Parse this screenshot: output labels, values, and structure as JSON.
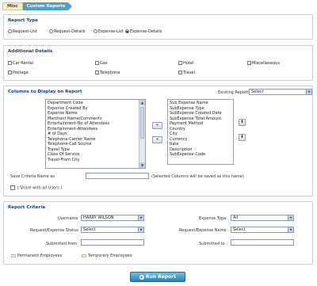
{
  "breadcrumb": {
    "misc": "Misc",
    "current": "Custom Reports"
  },
  "report_type": {
    "title": "Report Type",
    "options": [
      "Request-List",
      "Request-Details",
      "Expense-List",
      "Expense-Details"
    ],
    "selected": "Expense-Details"
  },
  "additional_details": {
    "title": "Additional Details",
    "checkboxes": [
      "Car Rental",
      "Gas",
      "Hotel",
      "Miscellaneous",
      "Postage",
      "Telephone",
      "Travel"
    ]
  },
  "columns": {
    "title": "Columns to Display on Report",
    "existing_reports_label": "Existing Reports",
    "existing_reports_value": "Select",
    "available": [
      "Department Code",
      "Expense Created By",
      "Expense Name",
      "Merchant Name/Comments",
      "Entertainment-No of Attendees",
      "Entertainment-Attendees",
      "# of Days",
      "Telephone-Carrier Name",
      "Telephone-Call Source",
      "Travel Type",
      "Class Of Service",
      "Travel-From City"
    ],
    "selected": [
      "Sub Expense Name",
      "SubExpense Type",
      "SubExpense Created Date",
      "SubExpense Total Amount",
      "Payment Method",
      "Country",
      "City",
      "Currency",
      "Rate",
      "Description",
      "SubExpense Code"
    ],
    "move_right": "»",
    "move_left": "«",
    "move_up": "⬆",
    "move_down": "⬇",
    "save_criteria_label": "Save Criteria Name as",
    "save_criteria_value": "",
    "save_hint": "(Selected Columns will be saved as this name)",
    "share_label": "( Share with all Users )"
  },
  "criteria": {
    "title": "Report Criteria",
    "username_label": "Username",
    "username_value": "HARRY WILSON",
    "expense_type_label": "Expense Type",
    "expense_type_value": "All",
    "req_status_label": "Request/Expense Status",
    "req_status_value": "Select",
    "req_name_label": "Request/Expense Name",
    "req_name_value": "Select",
    "submitted_from_label": "Submitted from",
    "submitted_from_value": "",
    "submitted_to_label": "Submitted to",
    "submitted_to_value": "",
    "legend_permanent": "Permanent Employees",
    "legend_temporary": "Temporary Employees"
  },
  "run_button": "Run Report",
  "colors": {
    "accent": "#4ea1c4",
    "title_blue": "#1b3d7a",
    "legend_permanent": "#f2f0d6",
    "legend_temporary": "#f6f0b0"
  }
}
